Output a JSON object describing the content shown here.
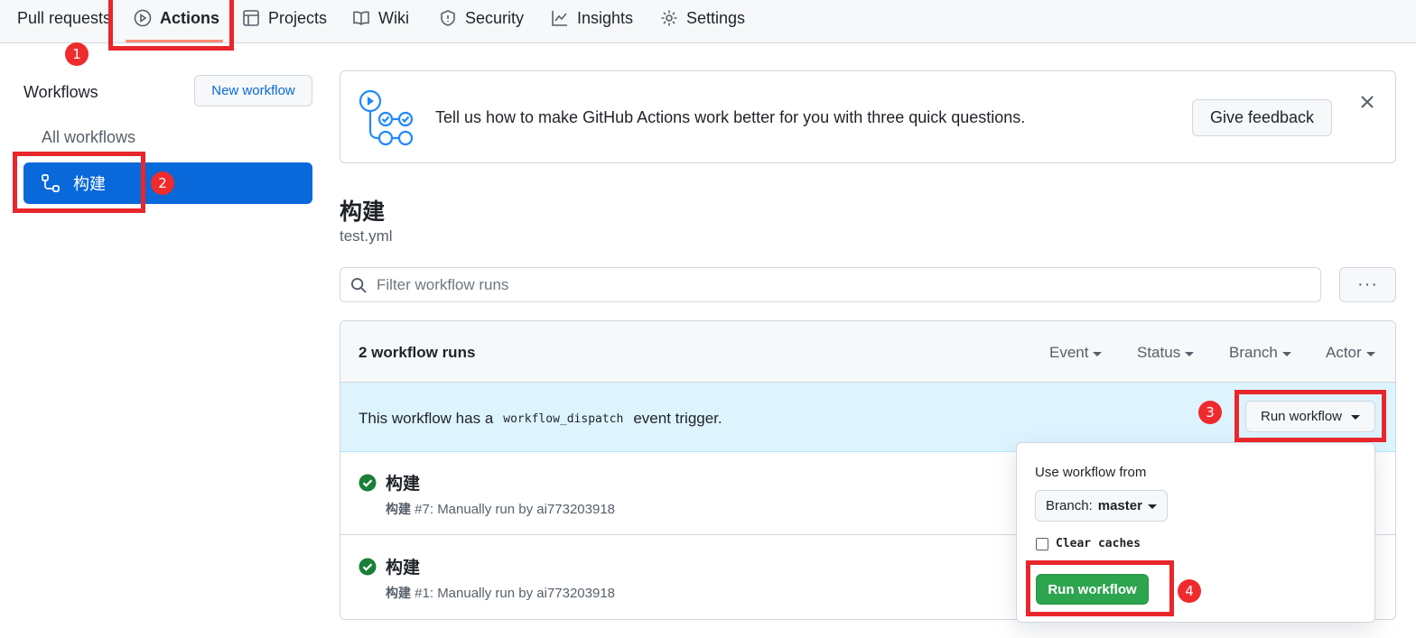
{
  "nav": {
    "tabs": [
      {
        "label": "Pull requests",
        "icon": "pull-request-icon"
      },
      {
        "label": "Actions",
        "icon": "play-icon",
        "active": true
      },
      {
        "label": "Projects",
        "icon": "table-icon"
      },
      {
        "label": "Wiki",
        "icon": "book-icon"
      },
      {
        "label": "Security",
        "icon": "shield-icon"
      },
      {
        "label": "Insights",
        "icon": "graph-icon"
      },
      {
        "label": "Settings",
        "icon": "gear-icon"
      }
    ]
  },
  "sidebar": {
    "title": "Workflows",
    "new_workflow": "New workflow",
    "all_workflows": "All workflows",
    "selected_workflow": "构建"
  },
  "banner": {
    "text": "Tell us how to make GitHub Actions work better for you with three quick questions.",
    "button": "Give feedback"
  },
  "workflow": {
    "title": "构建",
    "file": "test.yml",
    "filter_placeholder": "Filter workflow runs",
    "more": "···"
  },
  "runs": {
    "count_label": "2 workflow runs",
    "filters": [
      "Event",
      "Status",
      "Branch",
      "Actor"
    ],
    "dispatch": {
      "prefix": "This workflow has a",
      "code": "workflow_dispatch",
      "suffix": "event trigger.",
      "button": "Run workflow"
    },
    "items": [
      {
        "name": "构建",
        "wf": "构建",
        "meta": "#7: Manually run by ai773203918",
        "status": "success"
      },
      {
        "name": "构建",
        "wf": "构建",
        "meta": "#1: Manually run by ai773203918",
        "status": "success"
      }
    ]
  },
  "dropdown": {
    "label": "Use workflow from",
    "branch_prefix": "Branch:",
    "branch": "master",
    "clear_caches": "Clear caches",
    "run_button": "Run workflow"
  },
  "annotations": [
    "1",
    "2",
    "3",
    "4"
  ],
  "colors": {
    "accent": "#0969da",
    "success": "#1a7f37",
    "run_button": "#2da44e",
    "annotation": "#e8262b"
  }
}
